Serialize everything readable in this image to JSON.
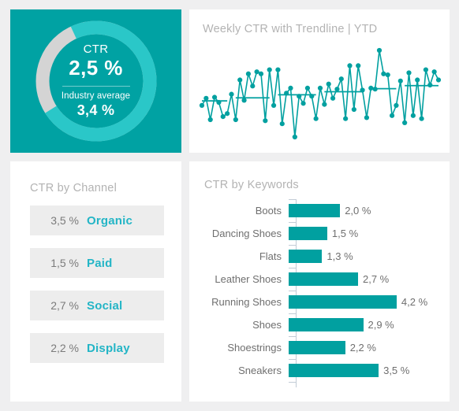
{
  "theme": {
    "page_bg": "#efeff0",
    "panel_bg": "#ffffff",
    "teal_panel": "#00a2a3",
    "teal_bar": "#01a0a0",
    "teal_arc_active": "#2ac7c8",
    "arc_remainder": "#d4d4d4",
    "label_teal": "#23b5c6",
    "title_grey": "#b3b3b3",
    "text_grey": "#6f6f6f"
  },
  "donut": {
    "label": "CTR",
    "value": "2,5 %",
    "sub_label": "Industry average",
    "sub_value": "3,4 %",
    "percent_filled": 73
  },
  "sparkline": {
    "title": "Weekly CTR with Trendline | YTD"
  },
  "channel": {
    "title": "CTR by Channel",
    "rows": [
      {
        "value": "3,5 %",
        "name": "Organic"
      },
      {
        "value": "1,5 %",
        "name": "Paid"
      },
      {
        "value": "2,7 %",
        "name": "Social"
      },
      {
        "value": "2,2 %",
        "name": "Display"
      }
    ]
  },
  "keywords": {
    "title": "CTR by Keywords"
  },
  "chart_data": [
    {
      "type": "bar",
      "orientation": "horizontal",
      "title": "CTR by Keywords",
      "xlabel": "",
      "ylabel": "",
      "categories": [
        "Boots",
        "Dancing Shoes",
        "Flats",
        "Leather Shoes",
        "Running Shoes",
        "Shoes",
        "Shoestrings",
        "Sneakers"
      ],
      "values": [
        2.0,
        1.5,
        1.3,
        2.7,
        4.2,
        2.9,
        2.2,
        3.5
      ],
      "value_labels": [
        "2,0 %",
        "1,5 %",
        "1,3 %",
        "2,7 %",
        "4,2 %",
        "2,9 %",
        "2,2 %",
        "3,5 %"
      ],
      "xlim": [
        0,
        4.2
      ],
      "grid": false,
      "legend": "none",
      "unit": "%"
    },
    {
      "type": "pie",
      "subtype": "donut",
      "title": "CTR",
      "labels": [
        "CTR",
        "Remainder"
      ],
      "values": [
        73,
        27
      ],
      "center_value": "2,5 %",
      "center_sub_label": "Industry average",
      "center_sub_value": "3,4 %",
      "legend": "none"
    },
    {
      "type": "line",
      "title": "Weekly CTR with Trendline | YTD",
      "xlabel": "",
      "ylabel": "",
      "grid": false,
      "legend": "none",
      "markers": true,
      "trendline": {
        "type": "horizontal-segments",
        "visible": true
      },
      "x": [
        1,
        2,
        3,
        4,
        5,
        6,
        7,
        8,
        9,
        10,
        11,
        12,
        13,
        14,
        15,
        16,
        17,
        18,
        19,
        20,
        21,
        22,
        23,
        24,
        25,
        26,
        27,
        28,
        29,
        30,
        31,
        32,
        33,
        34,
        35,
        36,
        37,
        38,
        39,
        40,
        41,
        42,
        43,
        44,
        45,
        46,
        47,
        48,
        49,
        50,
        51,
        52
      ],
      "values": [
        41,
        48,
        27,
        49,
        44,
        30,
        33,
        52,
        27,
        66,
        46,
        72,
        60,
        74,
        72,
        26,
        76,
        41,
        76,
        23,
        53,
        58,
        10,
        50,
        43,
        58,
        50,
        28,
        58,
        42,
        62,
        48,
        57,
        67,
        28,
        80,
        37,
        80,
        56,
        29,
        58,
        57,
        95,
        72,
        71,
        31,
        41,
        65,
        24,
        73,
        31,
        66,
        28,
        76,
        61,
        74,
        66
      ]
    }
  ],
  "channel_chart": {
    "type": "table",
    "title": "CTR by Channel",
    "columns": [
      "Value",
      "Channel"
    ],
    "rows": [
      [
        "3,5 %",
        "Organic"
      ],
      [
        "1,5 %",
        "Paid"
      ],
      [
        "2,7 %",
        "Social"
      ],
      [
        "2,2 %",
        "Display"
      ]
    ]
  }
}
